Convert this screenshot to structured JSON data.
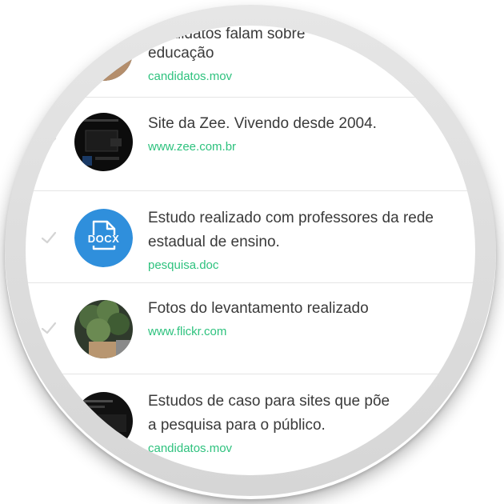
{
  "items": [
    {
      "title_line1": "candidatos falam sobre",
      "title_line2": "educação",
      "link": "candidatos.mov",
      "thumb_icon": "video-photo-thumbnail",
      "checked": false
    },
    {
      "title_line1": "Site da Zee. Vivendo desde 2004.",
      "title_line2": "",
      "link": "www.zee.com.br",
      "thumb_icon": "website-screenshot-thumbnail",
      "checked": true
    },
    {
      "title_line1": "Estudo realizado com professores da rede",
      "title_line2": "estadual de ensino.",
      "link": "pesquisa.doc",
      "thumb_icon": "docx-file-icon",
      "thumb_label": "DOCX",
      "checked": true
    },
    {
      "title_line1": "Fotos do levantamento realizado",
      "title_line2": "",
      "link": "www.flickr.com",
      "thumb_icon": "plant-photo-thumbnail",
      "checked": true
    },
    {
      "title_line1": "Estudos de caso para sites que põe",
      "title_line2": "a pesquisa para o público.",
      "link": "candidatos.mov",
      "thumb_icon": "website-screenshot-thumbnail",
      "checked": false
    }
  ],
  "colors": {
    "title": "#3a3a3a",
    "link": "#2ec27e",
    "docx_circle": "#2f8fdc",
    "divider": "#e4e4e4",
    "check": "#d4d4d4"
  }
}
